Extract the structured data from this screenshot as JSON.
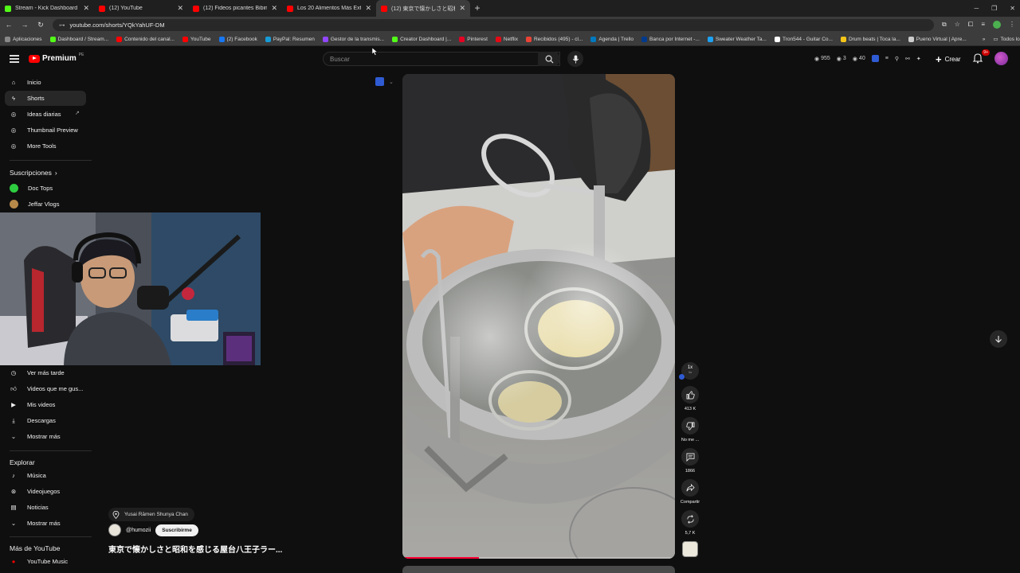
{
  "browser": {
    "tabs": [
      {
        "title": "Stream - Kick Dashboard",
        "favicon_color": "#53fc18",
        "active": false
      },
      {
        "title": "(12) YouTube",
        "favicon_color": "#ff0000",
        "active": false
      },
      {
        "title": "(12) Fideos picantes Bibim con",
        "favicon_color": "#ff0000",
        "active": false
      },
      {
        "title": "Los 20 Alimentos Más Extraños",
        "favicon_color": "#ff0000",
        "active": false
      },
      {
        "title": "(12) 東京で懐かしさと昭和を感",
        "favicon_color": "#ff0000",
        "active": true
      }
    ],
    "url": "youtube.com/shorts/YQkYahUF-DM",
    "bookmarks": [
      {
        "label": "Aplicaciones",
        "color": "#888888"
      },
      {
        "label": "Dashboard / Stream...",
        "color": "#53fc18"
      },
      {
        "label": "Contenido del canal...",
        "color": "#ff0000"
      },
      {
        "label": "YouTube",
        "color": "#ff0000"
      },
      {
        "label": "(2) Facebook",
        "color": "#1877f2"
      },
      {
        "label": "PayPal: Resumen",
        "color": "#179bd7"
      },
      {
        "label": "Gestor de la transmis...",
        "color": "#9146ff"
      },
      {
        "label": "Creator Dashboard |...",
        "color": "#53fc18"
      },
      {
        "label": "Pinterest",
        "color": "#e60023"
      },
      {
        "label": "Netflix",
        "color": "#e50914"
      },
      {
        "label": "Recibidos (495) - cl...",
        "color": "#ea4335"
      },
      {
        "label": "Agenda | Trello",
        "color": "#0079bf"
      },
      {
        "label": "Banca por Internet -...",
        "color": "#003a8c"
      },
      {
        "label": "Sweater Weather Ta...",
        "color": "#1da1f2"
      },
      {
        "label": "Tron544 - Guitar Co...",
        "color": "#ffffff"
      },
      {
        "label": "Drum beats | Toca la...",
        "color": "#f5c518"
      },
      {
        "label": "Pueno Virtual | Apre...",
        "color": "#cccccc"
      }
    ],
    "all_bookmarks": "Todos los favoritos"
  },
  "header": {
    "logo_text": "Premium",
    "logo_sup": "PE",
    "search_placeholder": "Buscar",
    "stats": [
      {
        "icon": "eye-icon",
        "value": "955"
      },
      {
        "icon": "eye-icon",
        "value": "3"
      },
      {
        "icon": "eye-icon",
        "value": "40"
      }
    ],
    "create_label": "Crear",
    "notif_badge": "9+"
  },
  "sidebar": {
    "main": [
      {
        "label": "Inicio",
        "icon": "home-icon"
      },
      {
        "label": "Shorts",
        "icon": "shorts-icon",
        "active": true
      },
      {
        "label": "Ideas diarias",
        "icon": "ideas-icon"
      },
      {
        "label": "Thumbnail Preview",
        "icon": "extension-icon"
      },
      {
        "label": "More Tools",
        "icon": "extension-icon"
      }
    ],
    "subs_heading": "Suscripciones",
    "subs": [
      {
        "label": "Doc Tops",
        "color": "#2ecc40"
      },
      {
        "label": "Jeffar Vlogs",
        "color": "#b88a4a"
      }
    ],
    "you": [
      {
        "label": "Ver más tarde",
        "icon": "clock-icon"
      },
      {
        "label": "Videos que me gus...",
        "icon": "like-icon"
      },
      {
        "label": "Mis videos",
        "icon": "play-square-icon"
      },
      {
        "label": "Descargas",
        "icon": "download-icon"
      },
      {
        "label": "Mostrar más",
        "icon": "chevron-down-icon"
      }
    ],
    "explore_heading": "Explorar",
    "explore": [
      {
        "label": "Música",
        "icon": "music-icon"
      },
      {
        "label": "Videojuegos",
        "icon": "gamepad-icon"
      },
      {
        "label": "Noticias",
        "icon": "news-icon"
      },
      {
        "label": "Mostrar más",
        "icon": "chevron-down-icon"
      }
    ],
    "more_heading": "Más de YouTube",
    "more": [
      {
        "label": "YouTube Music",
        "icon": "yt-music-icon"
      }
    ]
  },
  "short": {
    "location": "Yusai Rāmen Shunya Chan",
    "channel": "@humozii",
    "subscribe_label": "Suscribirme",
    "title": "東京で懐かしさと昭和を感じる屋台八王子ラー...",
    "progress": 0.28,
    "speed": "1x",
    "speed_sub": "1x",
    "likes": "413 K",
    "dislike_label": "No me ...",
    "comments": "1866",
    "share_label": "Compartir",
    "remix_count": "5,7 K"
  }
}
